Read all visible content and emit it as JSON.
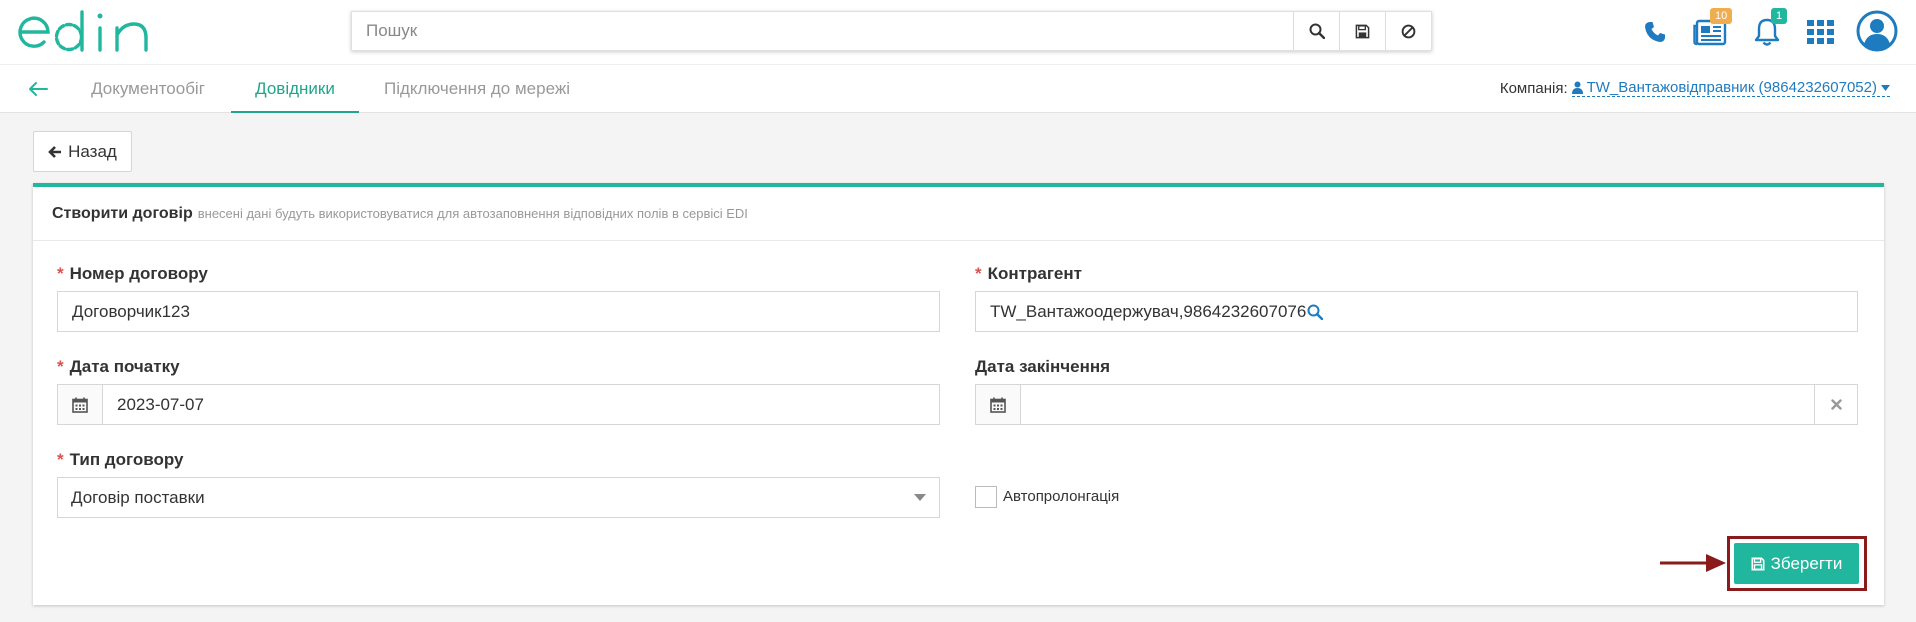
{
  "app": {
    "logo": "edin"
  },
  "search": {
    "placeholder": "Пошук"
  },
  "header": {
    "reports_badge": "10",
    "notifications_badge": "1"
  },
  "nav": {
    "tabs": [
      {
        "label": "Документообіг",
        "active": false
      },
      {
        "label": "Довідники",
        "active": true
      },
      {
        "label": "Підключення до мережі",
        "active": false
      }
    ],
    "company_label": "Компанія:",
    "company_value": "TW_Вантажовідправник (9864232607052)"
  },
  "back_button": {
    "label": "Назад"
  },
  "form": {
    "title": "Створити договір",
    "subtitle": "внесені дані будуть використовуватися для автозаповнення відповідних полів в сервісі EDI",
    "contract_number": {
      "label": "Номер договору",
      "value": "Договорчик123"
    },
    "counterparty": {
      "label": "Контрагент",
      "value": "TW_Вантажоодержувач,9864232607076"
    },
    "start_date": {
      "label": "Дата початку",
      "value": "2023-07-07"
    },
    "end_date": {
      "label": "Дата закінчення",
      "value": ""
    },
    "contract_type": {
      "label": "Тип договору",
      "value": "Договір поставки"
    },
    "auto_prolongation": {
      "label": "Автопролонгація",
      "checked": false
    },
    "save_label": "Зберегти"
  },
  "colors": {
    "accent": "#21b79e",
    "link": "#1f7bbf",
    "highlight": "#8b1a1a",
    "required": "#d9534f"
  }
}
